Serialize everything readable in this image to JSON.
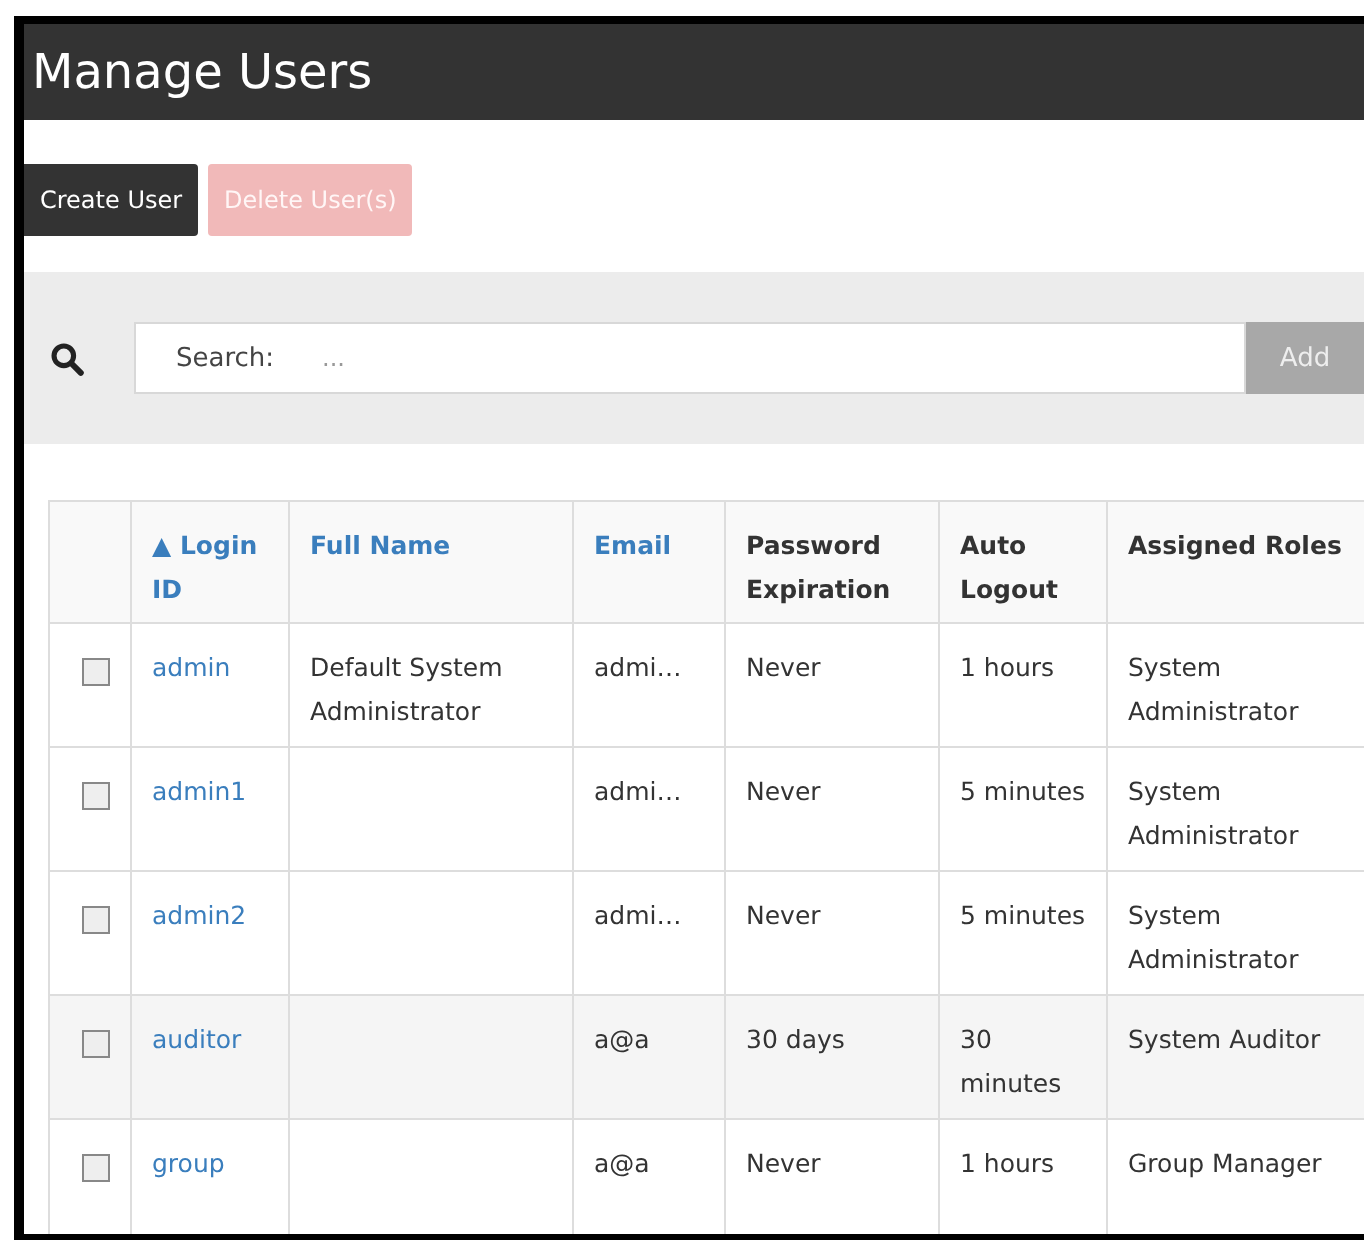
{
  "header": {
    "title": "Manage Users"
  },
  "actions": [
    {
      "label": "Create User",
      "disabled": false
    },
    {
      "label": "Delete User(s)",
      "disabled": true
    }
  ],
  "search": {
    "label": "Search:",
    "placeholder": "...",
    "button": {
      "label": "Add",
      "disabled": true
    }
  },
  "table": {
    "columns": [
      {
        "label": "Login ID",
        "link": true,
        "sort_indicator": "▲"
      },
      {
        "label": "Full Name",
        "link": true
      },
      {
        "label": "Email",
        "link": true
      },
      {
        "label": "Password Expiration",
        "link": false
      },
      {
        "label": "Auto Logout",
        "link": false
      },
      {
        "label": "Assigned Roles",
        "link": false
      }
    ],
    "rows": [
      {
        "checked": false,
        "login_id": "admin",
        "full_name": "Default System Administrator",
        "email": "admi…",
        "password_expiration": "Never",
        "auto_logout": "1 hours",
        "assigned_roles": "System Administrator"
      },
      {
        "checked": false,
        "login_id": "admin1",
        "full_name": "",
        "email": "admi…",
        "password_expiration": "Never",
        "auto_logout": "5 minutes",
        "assigned_roles": "System Administrator"
      },
      {
        "checked": false,
        "login_id": "admin2",
        "full_name": "",
        "email": "admi…",
        "password_expiration": "Never",
        "auto_logout": "5 minutes",
        "assigned_roles": "System Administrator"
      },
      {
        "checked": false,
        "login_id": "auditor",
        "full_name": "",
        "email": "a@a",
        "password_expiration": "30 days",
        "auto_logout": "30 minutes",
        "assigned_roles": "System Auditor"
      },
      {
        "checked": false,
        "login_id": "group",
        "full_name": "",
        "email": "a@a",
        "password_expiration": "Never",
        "auto_logout": "1 hours",
        "assigned_roles": "Group Manager"
      }
    ]
  }
}
